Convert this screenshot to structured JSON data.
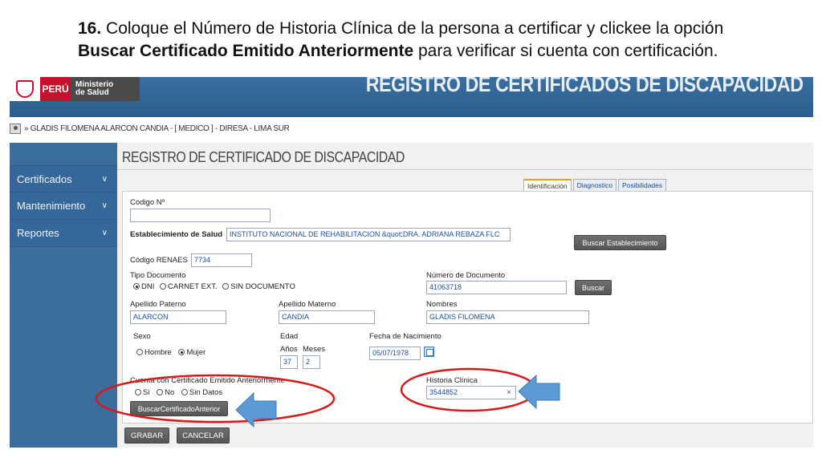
{
  "caption": {
    "number": "16.",
    "line1_text": " Coloque el Número de Historia Clínica de la persona a certificar y clickee la opción",
    "line2_bold": "Buscar Certificado Emitido Anteriormente",
    "line2_text": " para verificar si cuenta con certificación."
  },
  "header": {
    "country": "PERÚ",
    "ministry_line1": "Ministerio",
    "ministry_line2": "de Salud",
    "banner": "REGISTRO DE CERTIFICADOS DE DISCAPACIDAD"
  },
  "userbar": {
    "text": "» GLADIS FILOMENA ALARCON CANDIA - [ MEDICO ] - DIRESA - LIMA SUR"
  },
  "sidebar": {
    "items": [
      {
        "label": "Certificados",
        "icon": "chevron-down-icon"
      },
      {
        "label": "Mantenimiento",
        "icon": "chevron-down-icon"
      },
      {
        "label": "Reportes",
        "icon": "chevron-down-icon"
      }
    ]
  },
  "main": {
    "title": "REGISTRO DE CERTIFICADO DE DISCAPACIDAD",
    "tabs": [
      {
        "label": "Identificación",
        "active": true
      },
      {
        "label": "Diagnostico",
        "active": false
      },
      {
        "label": "Posibilidades",
        "active": false
      }
    ]
  },
  "form": {
    "codigo_label": "Codigo Nº",
    "codigo_value": "",
    "establecimiento_label": "Establecimiento de Salud",
    "establecimiento_value": "INSTITUTO NACIONAL DE REHABILITACION &quot;DRA. ADRIANA REBAZA FLC",
    "buscar_establecimiento": "Buscar Establecimiento",
    "renaes_label": "Código RENAES",
    "renaes_value": "7734",
    "tipo_documento_label": "Tipo Documento",
    "tipo_documento_options": [
      "DNI",
      "CARNET EXT.",
      "SIN DOCUMENTO"
    ],
    "tipo_documento_selected": "DNI",
    "numero_documento_label": "Número de Documento",
    "numero_documento_value": "41063718",
    "buscar": "Buscar",
    "apellido_paterno_label": "Apellido Paterno",
    "apellido_paterno_value": "ALARCON",
    "apellido_materno_label": "Apellido Materno",
    "apellido_materno_value": "CANDIA",
    "nombres_label": "Nombres",
    "nombres_value": "GLADIS FILOMENA",
    "sexo_label": "Sexo",
    "sexo_options": [
      "Hombre",
      "Mujer"
    ],
    "sexo_selected": "Mujer",
    "edad_label": "Edad",
    "anos_label": "Años",
    "meses_label": "Meses",
    "anos_value": "37",
    "meses_value": "2",
    "fecha_label": "Fecha de Nacimiento",
    "fecha_value": "05/07/1978",
    "certificado_label": "Cuenta con Certificado Emitido Anteriormente",
    "certificado_options": [
      "Si",
      "No",
      "Sin Datos"
    ],
    "buscar_certificado": "BuscarCertificadoAnterior",
    "historia_label": "Historia Clínica",
    "historia_value": "3544852",
    "clear_glyph": "×"
  },
  "actions": {
    "grabar": "GRABAR",
    "cancelar": "CANCELAR"
  },
  "colors": {
    "annotation_red": "#d7191c",
    "arrow_blue": "#5b9bd5",
    "sidebar_blue": "#3b6e9d"
  }
}
